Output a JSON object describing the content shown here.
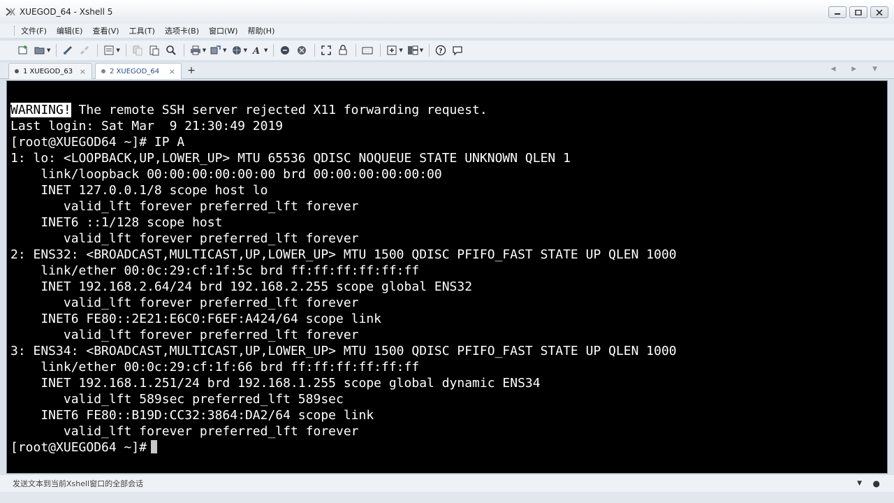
{
  "window": {
    "title": "XUEGOD_64 - Xshell 5"
  },
  "menu": [
    {
      "label": "文件(F)"
    },
    {
      "label": "编辑(E)"
    },
    {
      "label": "查看(V)"
    },
    {
      "label": "工具(T)"
    },
    {
      "label": "选项卡(B)"
    },
    {
      "label": "窗口(W)"
    },
    {
      "label": "帮助(H)"
    }
  ],
  "tabs": [
    {
      "label": "1 XUEGOD_63",
      "active": false
    },
    {
      "label": "2 XUEGOD_64",
      "active": true
    }
  ],
  "terminal": {
    "warning_badge": "WARNING!",
    "warning_rest": " The remote SSH server rejected X11 forwarding request.",
    "lines": [
      "Last login: Sat Mar  9 21:30:49 2019",
      "[root@XUEGOD64 ~]# IP A",
      "1: lo: <LOOPBACK,UP,LOWER_UP> MTU 65536 QDISC NOQUEUE STATE UNKNOWN QLEN 1",
      "    link/loopback 00:00:00:00:00:00 brd 00:00:00:00:00:00",
      "    INET 127.0.0.1/8 scope host lo",
      "       valid_lft forever preferred_lft forever",
      "    INET6 ::1/128 scope host",
      "       valid_lft forever preferred_lft forever",
      "2: ENS32: <BROADCAST,MULTICAST,UP,LOWER_UP> MTU 1500 QDISC PFIFO_FAST STATE UP QLEN 1000",
      "    link/ether 00:0c:29:cf:1f:5c brd ff:ff:ff:ff:ff:ff",
      "    INET 192.168.2.64/24 brd 192.168.2.255 scope global ENS32",
      "       valid_lft forever preferred_lft forever",
      "    INET6 FE80::2E21:E6C0:F6EF:A424/64 scope link",
      "       valid_lft forever preferred_lft forever",
      "3: ENS34: <BROADCAST,MULTICAST,UP,LOWER_UP> MTU 1500 QDISC PFIFO_FAST STATE UP QLEN 1000",
      "    link/ether 00:0c:29:cf:1f:66 brd ff:ff:ff:ff:ff:ff",
      "    INET 192.168.1.251/24 brd 192.168.1.255 scope global dynamic ENS34",
      "       valid_lft 589sec preferred_lft 589sec",
      "    INET6 FE80::B19D:CC32:3864:DA2/64 scope link",
      "       valid_lft forever preferred_lft forever"
    ],
    "prompt": "[root@XUEGOD64 ~]#"
  },
  "status": {
    "send_text": "发送文本到当前Xshell窗口的全部会话"
  },
  "icons": [
    "xshell-app-icon",
    "new-session-icon",
    "open-icon",
    "connect-icon",
    "disconnect-icon",
    "properties-icon",
    "copy-icon",
    "paste-icon",
    "find-icon",
    "print-icon",
    "transfer-icon",
    "globe-icon",
    "font-icon",
    "xftp-icon",
    "xmanager-icon",
    "fullscreen-icon",
    "lock-icon",
    "keyboard-icon",
    "add-icon",
    "layout-icon",
    "help-icon",
    "chat-icon"
  ],
  "colors": {
    "terminal_bg": "#000000",
    "terminal_fg": "#ffffff",
    "chrome_bg": "#eef2f6"
  }
}
